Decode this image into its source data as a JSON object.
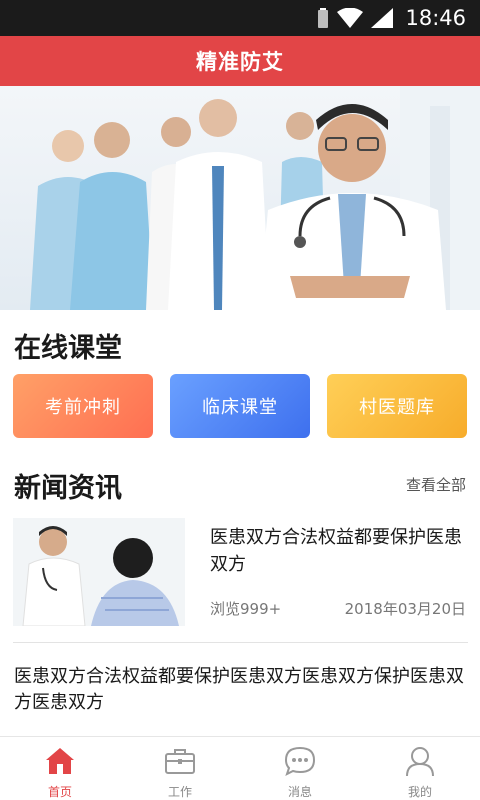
{
  "status_bar": {
    "time": "18:46"
  },
  "header": {
    "title": "精准防艾"
  },
  "online_class": {
    "title": "在线课堂",
    "buttons": [
      {
        "label": "考前冲刺"
      },
      {
        "label": "临床课堂"
      },
      {
        "label": "村医题库"
      }
    ]
  },
  "news": {
    "title": "新闻资讯",
    "view_all": "查看全部",
    "items": [
      {
        "title": "医患双方合法权益都要保护医患双方",
        "views": "浏览999+",
        "date": "2018年03月20日"
      },
      {
        "title": "医患双方合法权益都要保护医患双方医患双方保护医患双方医患双方"
      }
    ]
  },
  "tabs": [
    {
      "label": "首页",
      "icon": "home-icon",
      "active": true
    },
    {
      "label": "工作",
      "icon": "briefcase-icon",
      "active": false
    },
    {
      "label": "消息",
      "icon": "message-icon",
      "active": false
    },
    {
      "label": "我的",
      "icon": "user-icon",
      "active": false
    }
  ],
  "colors": {
    "primary": "#e24547",
    "tab_inactive": "#888888"
  }
}
